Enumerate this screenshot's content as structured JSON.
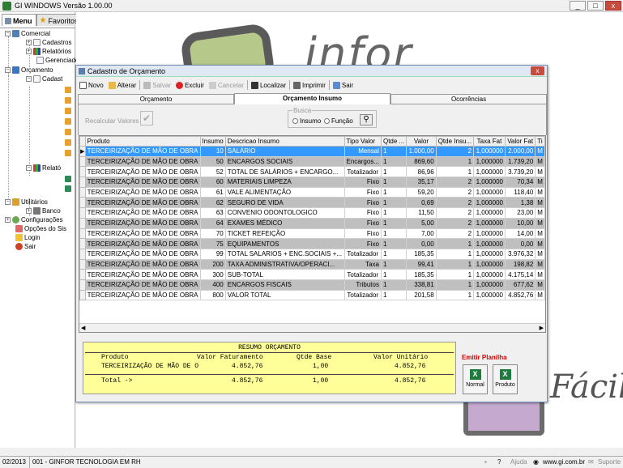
{
  "app": {
    "title": "GI WINDOWS  Versão  1.00.00"
  },
  "window_controls": {
    "minimize": "_",
    "maximize": "□",
    "close": "x"
  },
  "left_panel": {
    "tabs": [
      {
        "label": "Menu"
      },
      {
        "label": "Favoritos"
      }
    ],
    "tree": [
      {
        "label": "Comercial",
        "exp": "−"
      },
      {
        "label": "Cadastros",
        "exp": "+"
      },
      {
        "label": "Relatórios",
        "exp": "+"
      },
      {
        "label": "Gerenciador",
        "exp": ""
      },
      {
        "label": "Orçamento",
        "exp": "−"
      },
      {
        "label": "Cadast",
        "exp": "−"
      },
      {
        "label": "Relató",
        "exp": "−"
      },
      {
        "label": "Utilitários",
        "exp": "−"
      },
      {
        "label": "Banco",
        "exp": "+"
      },
      {
        "label": "Configurações",
        "exp": "+"
      },
      {
        "label": "Opções do Sis",
        "exp": ""
      },
      {
        "label": "Login",
        "exp": ""
      },
      {
        "label": "Sair",
        "exp": ""
      }
    ]
  },
  "background": {
    "logo_text": "infor",
    "tagline": "Fácil"
  },
  "dialog": {
    "title": "Cadastro de Orçamento",
    "close": "x",
    "toolbar": [
      {
        "label": "Novo",
        "enabled": true,
        "icon": "new-doc-icon"
      },
      {
        "label": "Alterar",
        "enabled": true,
        "icon": "edit-folder-icon"
      },
      {
        "label": "Salvar",
        "enabled": false,
        "icon": "save-icon"
      },
      {
        "label": "Excluir",
        "enabled": true,
        "icon": "delete-icon"
      },
      {
        "label": "Cancelar",
        "enabled": false,
        "icon": "cancel-icon"
      },
      {
        "label": "Localizar",
        "enabled": true,
        "icon": "binoculars-icon"
      },
      {
        "label": "Imprimir",
        "enabled": true,
        "icon": "printer-icon"
      },
      {
        "label": "Sair",
        "enabled": true,
        "icon": "exit-icon"
      }
    ],
    "tabs": [
      {
        "label": "Orçamento",
        "active": false
      },
      {
        "label": "Orçamento Insumo",
        "active": true
      },
      {
        "label": "Ocorrências",
        "active": false
      }
    ],
    "recalc_label": "Recalcular Valores",
    "busca": {
      "legend": "Busca",
      "options": [
        "Insumo",
        "Função"
      ]
    },
    "grid": {
      "columns": [
        "Produto",
        "Insumo",
        "Descricao Insumo",
        "Tipo Valor",
        "Qtde ...",
        "Valor",
        "Qtde Insu...",
        "Taxa Fat",
        "Valor Fat",
        "Ti"
      ],
      "rows": [
        [
          "TERCEIRIZAÇÃO DE MÃO DE OBRA",
          "10",
          "SALÁRIO",
          "Mensal",
          "1",
          "1.000,00",
          "2",
          "1,000000",
          "2.000,00",
          "M"
        ],
        [
          "TERCEIRIZAÇÃO DE MÃO DE OBRA",
          "50",
          "ENCARGOS SOCIAIS",
          "Encargos...",
          "1",
          "869,60",
          "1",
          "1,000000",
          "1.739,20",
          "M"
        ],
        [
          "TERCEIRIZAÇÃO DE MÃO DE OBRA",
          "52",
          "TOTAL DE SALÁRIOS + ENCARGO...",
          "Totalizador",
          "1",
          "86,96",
          "1",
          "1,000000",
          "3.739,20",
          "M"
        ],
        [
          "TERCEIRIZAÇÃO DE MÃO DE OBRA",
          "60",
          "MATERIAIS LIMPEZA",
          "Fixo",
          "1",
          "35,17",
          "2",
          "1,000000",
          "70,34",
          "M"
        ],
        [
          "TERCEIRIZAÇÃO DE MÃO DE OBRA",
          "61",
          "VALE ALIMENTAÇÃO",
          "Fixo",
          "1",
          "59,20",
          "2",
          "1,000000",
          "118,40",
          "M"
        ],
        [
          "TERCEIRIZAÇÃO DE MÃO DE OBRA",
          "62",
          "SEGURO DE VIDA",
          "Fixo",
          "1",
          "0,69",
          "2",
          "1,000000",
          "1,38",
          "M"
        ],
        [
          "TERCEIRIZAÇÃO DE MÃO DE OBRA",
          "63",
          "CONVENIO ODONTOLOGICO",
          "Fixo",
          "1",
          "11,50",
          "2",
          "1,000000",
          "23,00",
          "M"
        ],
        [
          "TERCEIRIZAÇÃO DE MÃO DE OBRA",
          "64",
          "EXAMES MÉDICO",
          "Fixo",
          "1",
          "5,00",
          "2",
          "1,000000",
          "10,00",
          "M"
        ],
        [
          "TERCEIRIZAÇÃO DE MÃO DE OBRA",
          "70",
          "TICKET REFEIÇÃO",
          "Fixo",
          "1",
          "7,00",
          "2",
          "1,000000",
          "14,00",
          "M"
        ],
        [
          "TERCEIRIZAÇÃO DE MÃO DE OBRA",
          "75",
          "EQUIPAMENTOS",
          "Fixo",
          "1",
          "0,00",
          "1",
          "1,000000",
          "0,00",
          "M"
        ],
        [
          "TERCEIRIZAÇÃO DE MÃO DE OBRA",
          "99",
          "TOTAL SALARIOS + ENC.SOCIAIS +...",
          "Totalizador",
          "1",
          "185,35",
          "1",
          "1,000000",
          "3.976,32",
          "M"
        ],
        [
          "TERCEIRIZAÇÃO DE MÃO DE OBRA",
          "200",
          "TAXA ADMINISTRATIVA/OPERACI...",
          "Taxa",
          "1",
          "99,41",
          "1",
          "1,000000",
          "198,82",
          "M"
        ],
        [
          "TERCEIRIZAÇÃO DE MÃO DE OBRA",
          "300",
          "SUB-TOTAL",
          "Totalizador",
          "1",
          "185,35",
          "1",
          "1,000000",
          "4.175,14",
          "M"
        ],
        [
          "TERCEIRIZAÇÃO DE MÃO DE OBRA",
          "400",
          "ENCARGOS FISCAIS",
          "Tributos",
          "1",
          "338,81",
          "1",
          "1,000000",
          "677,62",
          "M"
        ],
        [
          "TERCEIRIZAÇÃO DE MÃO DE OBRA",
          "800",
          "VALOR TOTAL",
          "Totalizador",
          "1",
          "201,58",
          "1",
          "1,000000",
          "4.852,76",
          "M"
        ]
      ],
      "selected_row": 0,
      "row_indicator": "▶",
      "scroll_left": "◀",
      "scroll_right": "▶"
    },
    "resumo": {
      "title": "RESUMO ORÇAMENTO",
      "headers": {
        "produto": "Produto",
        "valor_fat": "Valor Faturamento",
        "qtde": "Qtde Base",
        "valor_unit": "Valor Unitário"
      },
      "row": {
        "produto": "TERCEIRIZAÇÃO DE MÃO DE O",
        "valor_fat": "4.852,76",
        "qtde": "1,00",
        "valor_unit": "4.852,76"
      },
      "total": {
        "label": "Total ->",
        "valor_fat": "4.852,76",
        "qtde": "1,00",
        "valor_unit": "4.852,76"
      }
    },
    "emitir": {
      "label": "Emitir Planilha",
      "buttons": [
        "Normal",
        "Produto"
      ]
    }
  },
  "statusbar": {
    "date": "02/2013",
    "company": "001 - GINFOR TECNOLOGIA EM RH",
    "ajuda": "Ajuda",
    "site": "www.gi.com.br",
    "suporte": "Suporte"
  },
  "colors": {
    "selected_row": "#3399ff",
    "odd_row": "#bfbfbf",
    "resumo_bg": "#ffff9a",
    "emitir_text": "#d60000"
  }
}
